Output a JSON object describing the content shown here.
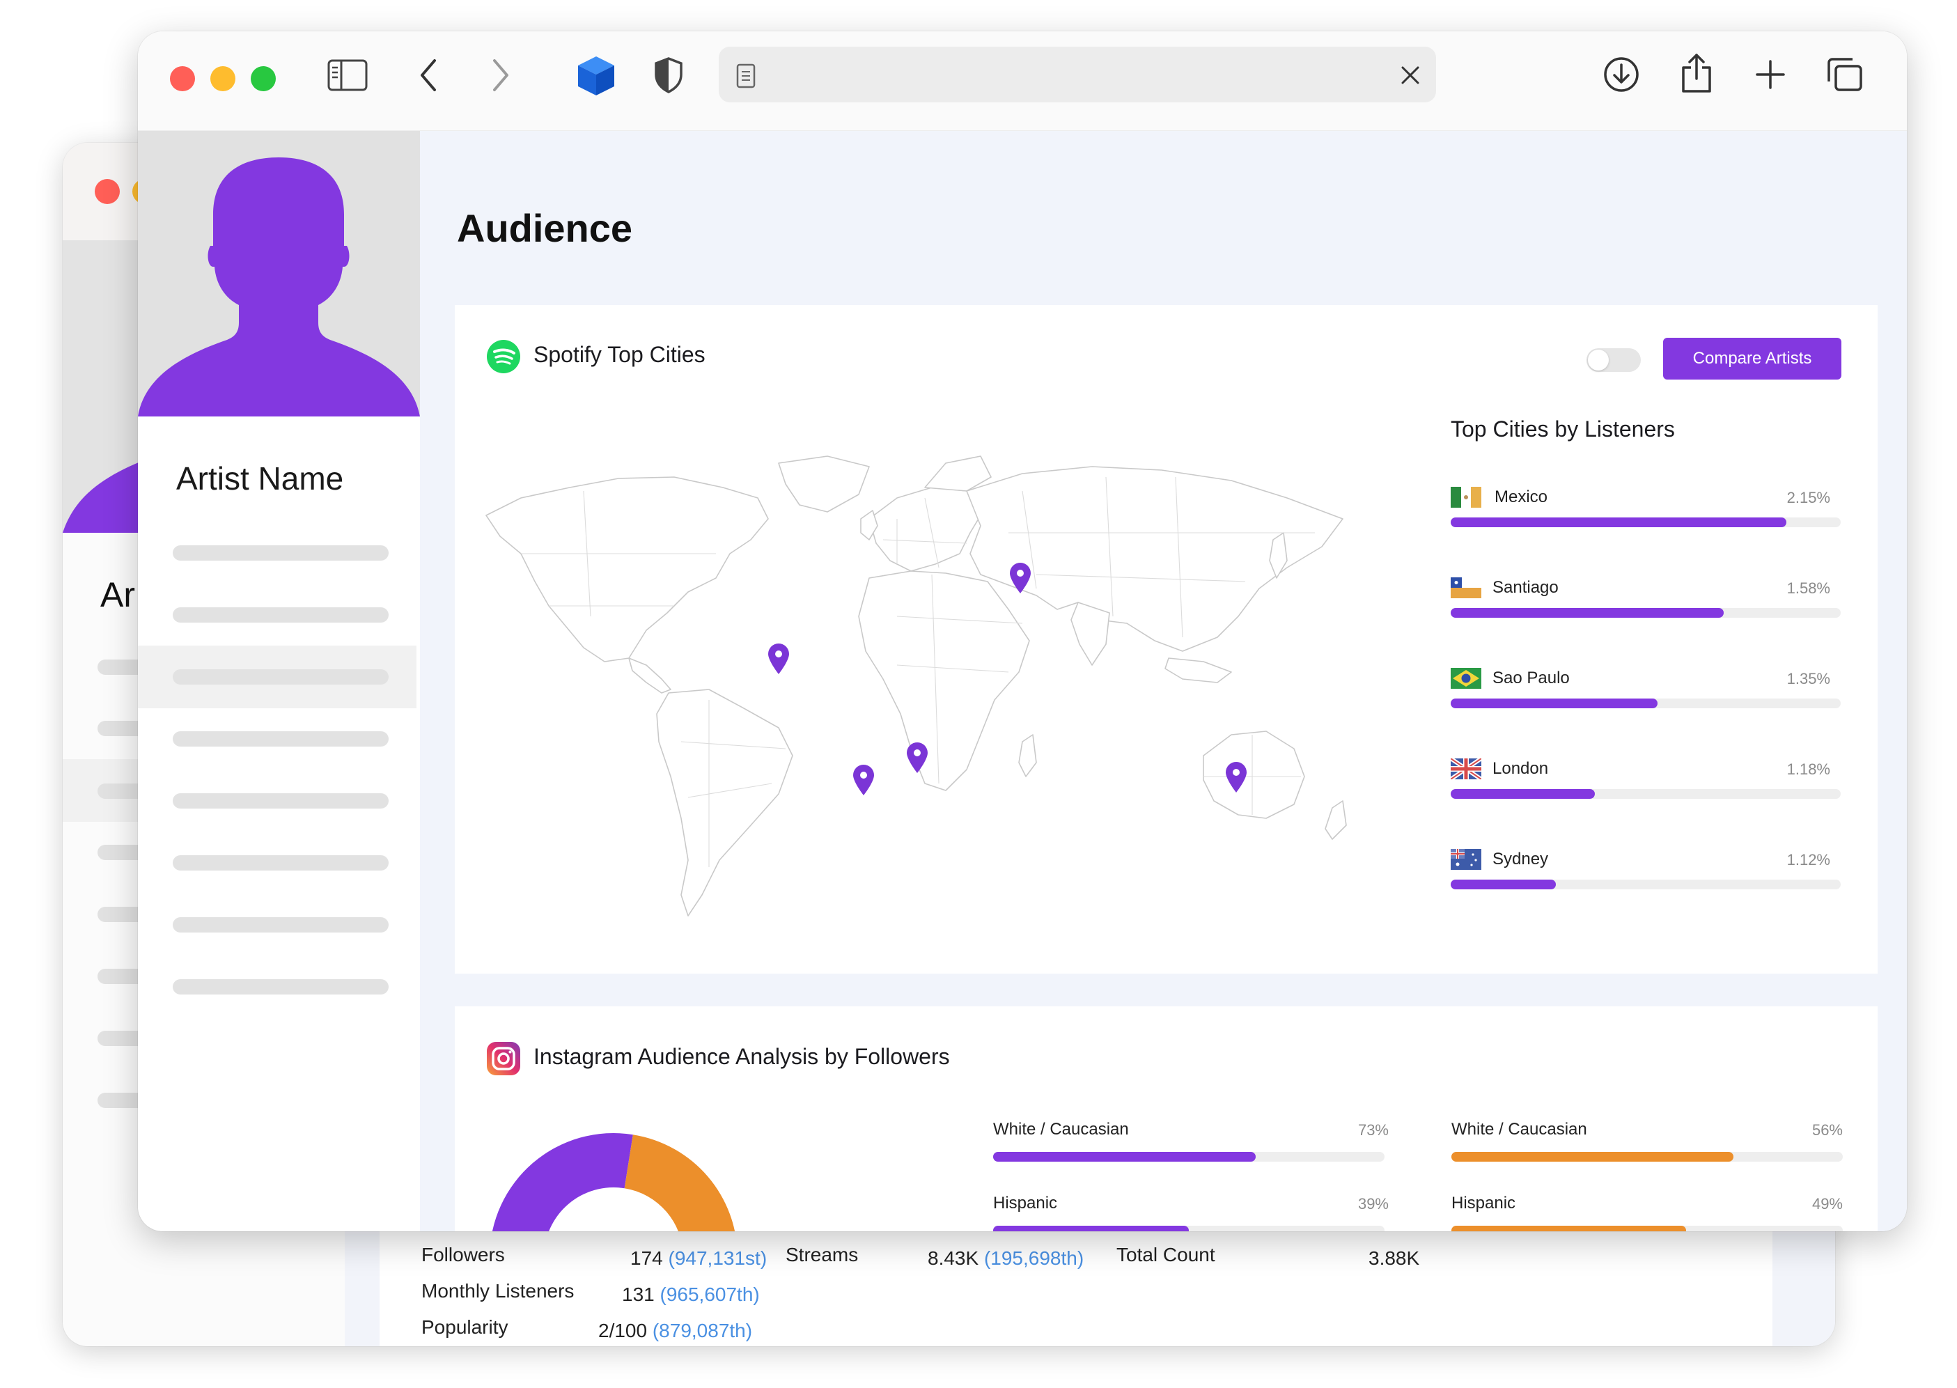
{
  "colors": {
    "accent": "#8338e0",
    "accent_orange": "#ec8f2b",
    "pin": "#7b35d6",
    "mac_red": "#ff5f57",
    "mac_yellow": "#febc2e",
    "mac_green": "#28c840",
    "rank_blue": "#4a90e2"
  },
  "back_window": {
    "artist_name_partial": "Ar",
    "stats": [
      {
        "label": "Followers",
        "value": "174",
        "rank": "(947,131st)"
      },
      {
        "label": "Monthly Listeners",
        "value": "131",
        "rank": "(965,607th)"
      },
      {
        "label": "Popularity",
        "value": "2/100",
        "rank": "(879,087th)"
      },
      {
        "label": "Streams",
        "value": "8.43K",
        "rank": "(195,698th)"
      },
      {
        "label": "Total Count",
        "value": "3.88K",
        "rank": ""
      }
    ]
  },
  "browser": {
    "icons": [
      "sidebar-icon",
      "back-arrow-icon",
      "forward-arrow-icon",
      "box-extension-icon",
      "shield-icon",
      "page-icon",
      "close-icon",
      "download-icon",
      "share-icon",
      "new-tab-icon",
      "tabs-overview-icon"
    ]
  },
  "sidebar": {
    "artist_name": "Artist Name"
  },
  "page": {
    "title": "Audience"
  },
  "spotify": {
    "title": "Spotify Top Cities",
    "compare_button": "Compare Artists",
    "toggle_on": false,
    "top_cities_heading": "Top Cities by Listeners",
    "cities": [
      {
        "name": "Mexico",
        "pct": "2.15%",
        "share": 0.86,
        "flag": "mexico"
      },
      {
        "name": "Santiago",
        "pct": "1.58%",
        "share": 0.7,
        "flag": "chile"
      },
      {
        "name": "Sao Paulo",
        "pct": "1.35%",
        "share": 0.53,
        "flag": "brazil"
      },
      {
        "name": "London",
        "pct": "1.18%",
        "share": 0.37,
        "flag": "uk"
      },
      {
        "name": "Sydney",
        "pct": "1.12%",
        "share": 0.27,
        "flag": "australia"
      }
    ]
  },
  "instagram": {
    "title": "Instagram Audience Analysis by Followers",
    "donut": {
      "purple_share": 0.8,
      "orange_share": 0.2
    },
    "col1": [
      {
        "label": "White / Caucasian",
        "pct": "73%",
        "share": 0.67
      },
      {
        "label": "Hispanic",
        "pct": "39%",
        "share": 0.5
      }
    ],
    "col2": [
      {
        "label": "White / Caucasian",
        "pct": "56%",
        "share": 0.72
      },
      {
        "label": "Hispanic",
        "pct": "49%",
        "share": 0.6
      }
    ]
  }
}
